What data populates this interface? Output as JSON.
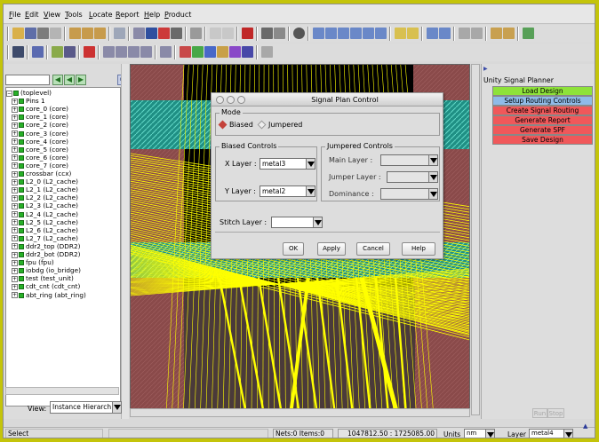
{
  "menubar": {
    "items": [
      "File",
      "Edit",
      "View",
      "Tools",
      "Locate",
      "Report",
      "Help",
      "Product"
    ]
  },
  "toolbar_icons": [
    "open-icon",
    "save-icon",
    "print-icon",
    "zoom-in-icon",
    "zoom-out-icon",
    "ruler-icon",
    "select-icon",
    "delete-icon",
    "undo-icon",
    "redo-icon",
    "grid-icon",
    "route-icon"
  ],
  "tree": {
    "search_value": "",
    "items": [
      {
        "label": "(toplevel)",
        "depth": 0,
        "expand": "−"
      },
      {
        "label": "Pins 1",
        "depth": 1,
        "expand": "+"
      },
      {
        "label": "core_0 (core)",
        "depth": 1,
        "expand": "+"
      },
      {
        "label": "core_1 (core)",
        "depth": 1,
        "expand": "+"
      },
      {
        "label": "core_2 (core)",
        "depth": 1,
        "expand": "+"
      },
      {
        "label": "core_3 (core)",
        "depth": 1,
        "expand": "+"
      },
      {
        "label": "core_4 (core)",
        "depth": 1,
        "expand": "+"
      },
      {
        "label": "core_5 (core)",
        "depth": 1,
        "expand": "+"
      },
      {
        "label": "core_6 (core)",
        "depth": 1,
        "expand": "+"
      },
      {
        "label": "core_7 (core)",
        "depth": 1,
        "expand": "+"
      },
      {
        "label": "crossbar (ccx)",
        "depth": 1,
        "expand": "+"
      },
      {
        "label": "L2_0 (L2_cache)",
        "depth": 1,
        "expand": "+"
      },
      {
        "label": "L2_1 (L2_cache)",
        "depth": 1,
        "expand": "+"
      },
      {
        "label": "L2_2 (L2_cache)",
        "depth": 1,
        "expand": "+"
      },
      {
        "label": "L2_3 (L2_cache)",
        "depth": 1,
        "expand": "+"
      },
      {
        "label": "L2_4 (L2_cache)",
        "depth": 1,
        "expand": "+"
      },
      {
        "label": "L2_5 (L2_cache)",
        "depth": 1,
        "expand": "+"
      },
      {
        "label": "L2_6 (L2_cache)",
        "depth": 1,
        "expand": "+"
      },
      {
        "label": "L2_7 (L2_cache)",
        "depth": 1,
        "expand": "+"
      },
      {
        "label": "ddr2_top (DDR2)",
        "depth": 1,
        "expand": "+"
      },
      {
        "label": "ddr2_bot (DDR2)",
        "depth": 1,
        "expand": "+"
      },
      {
        "label": "fpu (fpu)",
        "depth": 1,
        "expand": "+"
      },
      {
        "label": "iobdg (io_bridge)",
        "depth": 1,
        "expand": "+"
      },
      {
        "label": "test (test_unit)",
        "depth": 1,
        "expand": "+"
      },
      {
        "label": "cdt_cnt (cdt_cnt)",
        "depth": 1,
        "expand": "+"
      },
      {
        "label": "abt_ring (abt_ring)",
        "depth": 1,
        "expand": "+"
      }
    ]
  },
  "view": {
    "label": "View:",
    "value": "Instance Hierarch"
  },
  "dialog": {
    "title": "Signal Plan Control",
    "mode_label": "Mode",
    "mode_biased": "Biased",
    "mode_jumpered": "Jumpered",
    "biased_group": "Biased Controls",
    "x_layer_label": "X Layer :",
    "x_layer_value": "metal3",
    "y_layer_label": "Y Layer :",
    "y_layer_value": "metal2",
    "jumpered_group": "Jumpered Controls",
    "main_layer_label": "Main Layer :",
    "jumper_layer_label": "Jumper Layer :",
    "dominance_label": "Dominance :",
    "stitch_layer_label": "Stitch Layer :",
    "buttons": {
      "ok": "OK",
      "apply": "Apply",
      "cancel": "Cancel",
      "help": "Help"
    }
  },
  "planner": {
    "title": "Unity Signal Planner",
    "buttons": [
      {
        "label": "Load Design",
        "color": "#8ee23a"
      },
      {
        "label": "Setup Routing Controls",
        "color": "#8fbbe8"
      },
      {
        "label": "Create Signal Routing",
        "color": "#f0585a"
      },
      {
        "label": "Generate Report",
        "color": "#f0585a"
      },
      {
        "label": "Generate SPF",
        "color": "#f0585a"
      },
      {
        "label": "Save Design",
        "color": "#f0585a"
      }
    ],
    "run_label": "Run",
    "stop_label": "Stop"
  },
  "statusbar": {
    "mode": "Select",
    "nets": "Nets:0 Items:0",
    "coords": "1047812.50 : 1725085.00",
    "units_label": "Units",
    "units_value": "nm",
    "layer_label": "Layer",
    "layer_value": "metal4"
  },
  "colors": {
    "window_frame": "#c4c40a",
    "routing_wire": "#ffff00",
    "block_fill": "#8a4a4a",
    "cell_fill": "#26a69a"
  }
}
